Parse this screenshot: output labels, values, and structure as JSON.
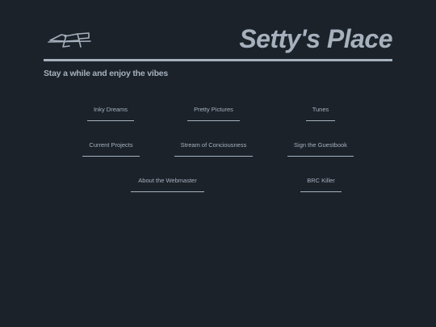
{
  "header": {
    "title": "Setty's Place",
    "tagline": "Stay a while and enjoy the vibes",
    "logo_icon": "drawing-logo-icon"
  },
  "nav": {
    "items": [
      {
        "label": "Inky Dreams"
      },
      {
        "label": "Pretty Pictures"
      },
      {
        "label": "Tunes"
      },
      {
        "label": "Current Projects"
      },
      {
        "label": "Stream of Conciousness"
      },
      {
        "label": "Sign the Guestbook"
      },
      {
        "label": "About the Webmaster"
      },
      {
        "label": "BRC Killer"
      }
    ]
  },
  "colors": {
    "background": "#1b222a",
    "foreground": "#a6b1bd"
  }
}
